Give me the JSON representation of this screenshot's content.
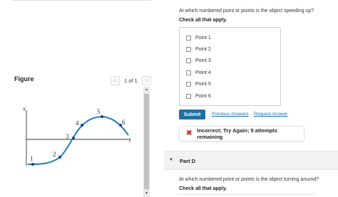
{
  "figure": {
    "title": "Figure",
    "pager": {
      "text": "1 of 1",
      "prev": "<",
      "next": ">"
    },
    "graph": {
      "x_axis_label": "x",
      "t_axis_label": "t",
      "points": [
        "1",
        "2",
        "3",
        "4",
        "5",
        "6"
      ]
    },
    "scrollbar": {
      "up": "▲",
      "down": "▼"
    }
  },
  "part_c": {
    "question": "At which numbered point or points is the object speeding up?",
    "instruction": "Check all that apply.",
    "choices": [
      "Point 1",
      "Point 2",
      "Point 3",
      "Point 4",
      "Point 5",
      "Point 6"
    ],
    "submit_label": "Submit",
    "previous_answers": "Previous Answers",
    "request_answer": "Request Answer",
    "feedback": "Incorrect; Try Again; 5 attempts remaining",
    "feedback_icon": "✖"
  },
  "part_d": {
    "arrow": "▼",
    "label": "Part D",
    "question": "At which numbered point or points is the object turning around?",
    "instruction": "Check all that apply."
  },
  "colors": {
    "submit_bg": "#1f6fa0",
    "link": "#1a6fb0",
    "error": "#d0312d",
    "curve": "#1f7fb5",
    "point": "#1a3d8f"
  }
}
